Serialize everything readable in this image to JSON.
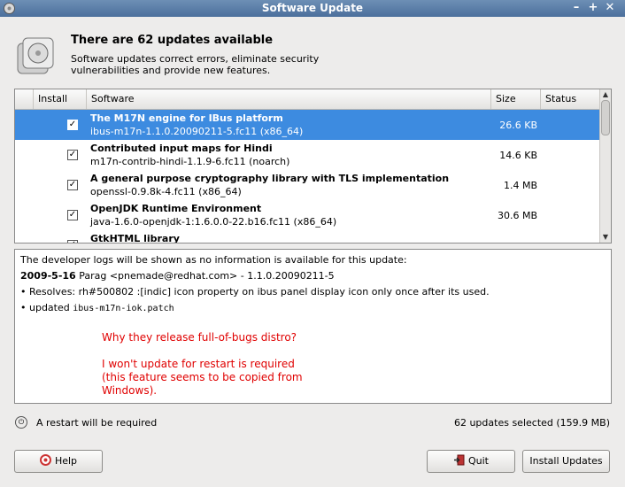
{
  "window": {
    "title": "Software Update"
  },
  "header": {
    "title": "There are 62 updates available",
    "subtitle": "Software updates correct errors, eliminate security vulnerabilities and provide new features."
  },
  "columns": {
    "install": "Install",
    "software": "Software",
    "size": "Size",
    "status": "Status"
  },
  "updates": [
    {
      "name": "The M17N engine for IBus platform",
      "package": "ibus-m17n-1.1.0.20090211-5.fc11 (x86_64)",
      "size": "26.6 KB",
      "checked": true,
      "selected": true
    },
    {
      "name": "Contributed input maps for Hindi",
      "package": "m17n-contrib-hindi-1.1.9-6.fc11 (noarch)",
      "size": "14.6 KB",
      "checked": true,
      "selected": false
    },
    {
      "name": "A general purpose cryptography library with TLS implementation",
      "package": "openssl-0.9.8k-4.fc11 (x86_64)",
      "size": "1.4 MB",
      "checked": true,
      "selected": false
    },
    {
      "name": "OpenJDK Runtime Environment",
      "package": "java-1.6.0-openjdk-1:1.6.0.0-22.b16.fc11 (x86_64)",
      "size": "30.6 MB",
      "checked": true,
      "selected": false
    },
    {
      "name": "GtkHTML library",
      "package": "",
      "size": "",
      "checked": true,
      "selected": false
    }
  ],
  "details": {
    "logs_note": "The developer logs will be shown as no information is available for this update:",
    "entry_date": "2009-5-16",
    "entry_author": "Parag <pnemade@redhat.com> - 1.1.0.20090211-5",
    "line1": "• Resolves: rh#500802 :[indic] icon property on ibus panel display icon only once after its used.",
    "line2_prefix": "• updated ",
    "line2_mono": "ibus-m17n-iok.patch",
    "annotation1": "Why they release full-of-bugs distro?",
    "annotation2": "I won't update for restart is required",
    "annotation3": "(this feature seems to be copied from",
    "annotation4": "Windows)."
  },
  "status": {
    "restart": "A restart will be required",
    "selected": "62 updates selected (159.9 MB)"
  },
  "buttons": {
    "help": "Help",
    "quit": "Quit",
    "install": "Install Updates"
  }
}
